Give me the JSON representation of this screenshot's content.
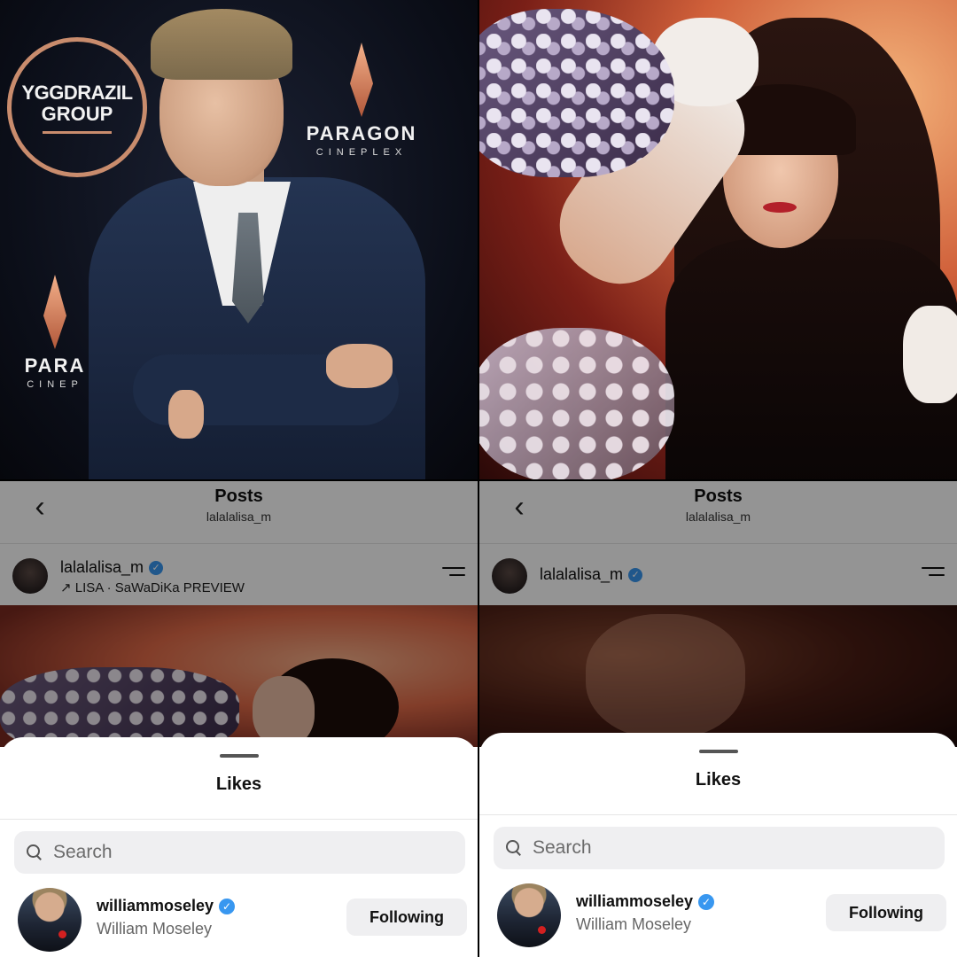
{
  "top_left_photo": {
    "backdrop_logo_1": {
      "line1": "YGGDRAZIL",
      "line2": "GROUP"
    },
    "backdrop_logo_2": {
      "name": "PARAGON",
      "sub": "CINEPLEX"
    },
    "backdrop_logo_3": {
      "name": "PARA",
      "sub": "CINEP"
    }
  },
  "screens": [
    {
      "header": {
        "title": "Posts",
        "subtitle": "lalalalisa_m"
      },
      "post": {
        "username": "lalalalisa_m",
        "music": "↗ LISA · SaWaDiKa PREVIEW"
      },
      "sheet": {
        "title": "Likes",
        "search_placeholder": "Search",
        "liker": {
          "username": "williammoseley",
          "full_name": "William Moseley",
          "button": "Following"
        }
      }
    },
    {
      "header": {
        "title": "Posts",
        "subtitle": "lalalalisa_m"
      },
      "post": {
        "username": "lalalalisa_m",
        "music": ""
      },
      "sheet": {
        "title": "Likes",
        "search_placeholder": "Search",
        "liker": {
          "username": "williammoseley",
          "full_name": "William Moseley",
          "button": "Following"
        }
      }
    }
  ],
  "icons": {
    "back": "chevron-left-icon",
    "verified": "verified-badge-icon",
    "menu": "menu-icon",
    "search": "search-icon"
  },
  "colors": {
    "verified": "#3897f0",
    "logo_accent": "#c98c6d"
  }
}
